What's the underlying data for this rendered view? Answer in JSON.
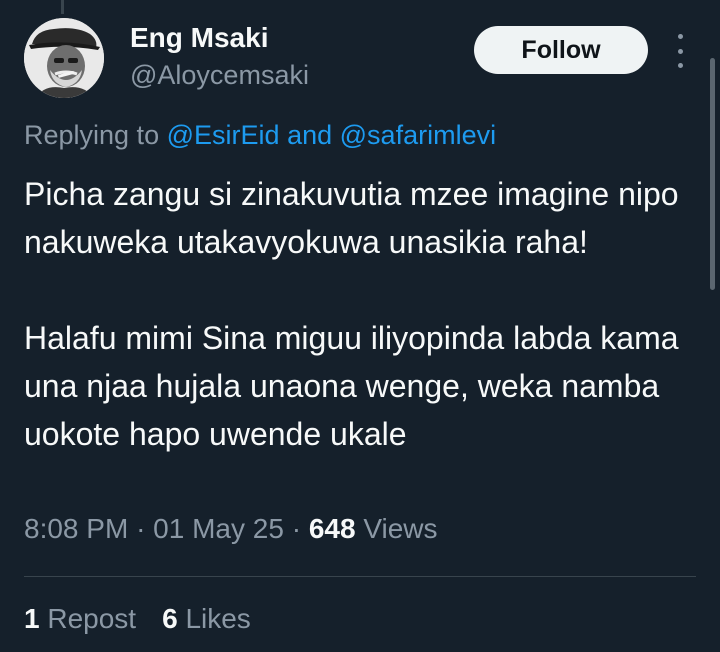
{
  "author": {
    "name": "Eng Msaki",
    "handle": "@Aloycemsaki"
  },
  "follow_label": "Follow",
  "reply": {
    "prefix": "Replying to",
    "mention1": "@EsirEid",
    "connector": "and",
    "mention2": "@safarimlevi"
  },
  "tweet": {
    "paragraph1": "Picha zangu si zinakuvutia mzee imagine nipo nakuweka utakavyokuwa unasikia raha!",
    "paragraph2": "Halafu mimi Sina miguu iliyopinda labda kama una njaa hujala unaona wenge, weka namba uokote hapo uwende ukale"
  },
  "meta": {
    "time": "8:08 PM",
    "separator": "·",
    "date": "01 May 25",
    "views_count": "648",
    "views_label": "Views"
  },
  "stats": {
    "reposts_count": "1",
    "reposts_label": "Repost",
    "likes_count": "6",
    "likes_label": "Likes"
  },
  "colors": {
    "background": "#15202b",
    "accent": "#1d9bf0",
    "secondary_text": "#8b98a5"
  }
}
